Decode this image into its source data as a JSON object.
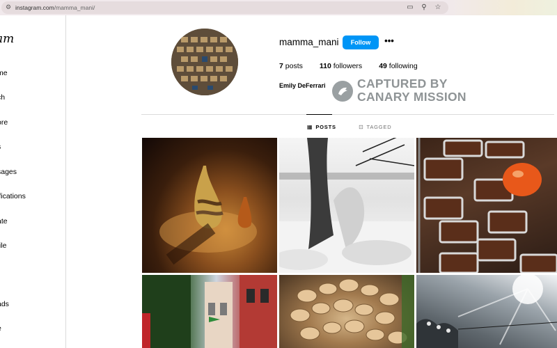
{
  "browser": {
    "url_host": "instagram.com",
    "url_path": "/mamma_mani/",
    "icons": [
      "site-settings-icon",
      "cast-icon",
      "zoom-icon",
      "bookmark-star-icon"
    ]
  },
  "sidebar": {
    "logo": "am",
    "items": [
      {
        "label": "me"
      },
      {
        "label": "ch"
      },
      {
        "label": "ore"
      },
      {
        "label": "s"
      },
      {
        "label": "sages"
      },
      {
        "label": "ifications"
      },
      {
        "label": "ate"
      },
      {
        "label": "file"
      },
      {
        "label": "ads"
      },
      {
        "label": "e"
      }
    ]
  },
  "profile": {
    "username": "mamma_mani",
    "follow_label": "Follow",
    "more_label": "•••",
    "posts_count": "7",
    "posts_label": "posts",
    "followers_count": "110",
    "followers_label": "followers",
    "following_count": "49",
    "following_label": "following",
    "full_name": "Emily DeFerrari"
  },
  "watermark": {
    "line1": "CAPTURED BY",
    "line2": "CANARY MISSION"
  },
  "tabs": [
    {
      "label": "POSTS",
      "icon": "grid-icon",
      "active": true
    },
    {
      "label": "TAGGED",
      "icon": "tagged-icon",
      "active": false
    }
  ],
  "grid": [
    {
      "alt": "vases-in-light"
    },
    {
      "alt": "snowy-tree"
    },
    {
      "alt": "baked-bars"
    },
    {
      "alt": "street-with-flags"
    },
    {
      "alt": "mushrooms"
    },
    {
      "alt": "cloudy-sky"
    }
  ],
  "colors": {
    "follow_button": "#0095f6",
    "watermark": "#8f9496",
    "divider": "#dbdbdb"
  }
}
